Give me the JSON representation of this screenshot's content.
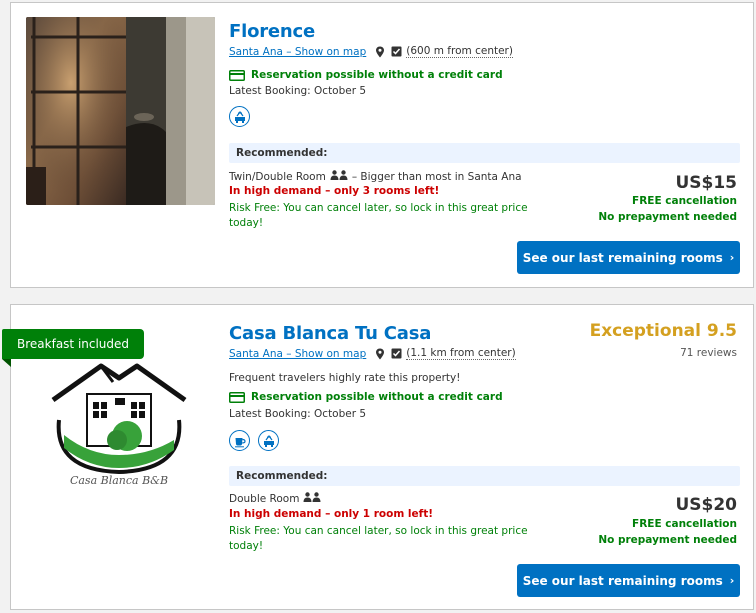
{
  "listings": [
    {
      "name": "Florence",
      "location": "Santa Ana – Show on map",
      "distance": "(600 m from center)",
      "no_credit_card": "Reservation possible without a credit card",
      "latest_booking": "Latest Booking: October 5",
      "facilities": [
        "shuttle-icon"
      ],
      "recommended_label": "Recommended:",
      "room_type": "Twin/Double Room",
      "room_note": "– Bigger than most in Santa Ana",
      "demand": "In high demand – only 3 rooms left!",
      "risk_free": "Risk Free: You can cancel later, so lock in this great price today!",
      "price": "US$15",
      "free_cancellation": "FREE cancellation",
      "no_prepayment": "No prepayment needed",
      "cta": "See our last remaining rooms"
    },
    {
      "name": "Casa Blanca Tu Casa",
      "ribbon": "Breakfast included",
      "score_label": "Exceptional 9.5",
      "reviews": "71 reviews",
      "location": "Santa Ana – Show on map",
      "distance": "(1.1 km from center)",
      "frequent": "Frequent travelers highly rate this property!",
      "no_credit_card": "Reservation possible without a credit card",
      "latest_booking": "Latest Booking: October 5",
      "facilities": [
        "coffee-cup-icon",
        "shuttle-icon"
      ],
      "recommended_label": "Recommended:",
      "room_type": "Double Room",
      "demand": "In high demand – only 1 room left!",
      "risk_free": "Risk Free: You can cancel later, so lock in this great price today!",
      "price": "US$20",
      "free_cancellation": "FREE cancellation",
      "no_prepayment": "No prepayment needed",
      "cta": "See our last remaining rooms",
      "logo_text": "Casa Blanca B&B"
    }
  ],
  "colors": {
    "link": "#0071c2",
    "green": "#008009",
    "alert": "#cc0000",
    "score": "#d4a020",
    "recommended_bg": "#ebf3ff"
  }
}
